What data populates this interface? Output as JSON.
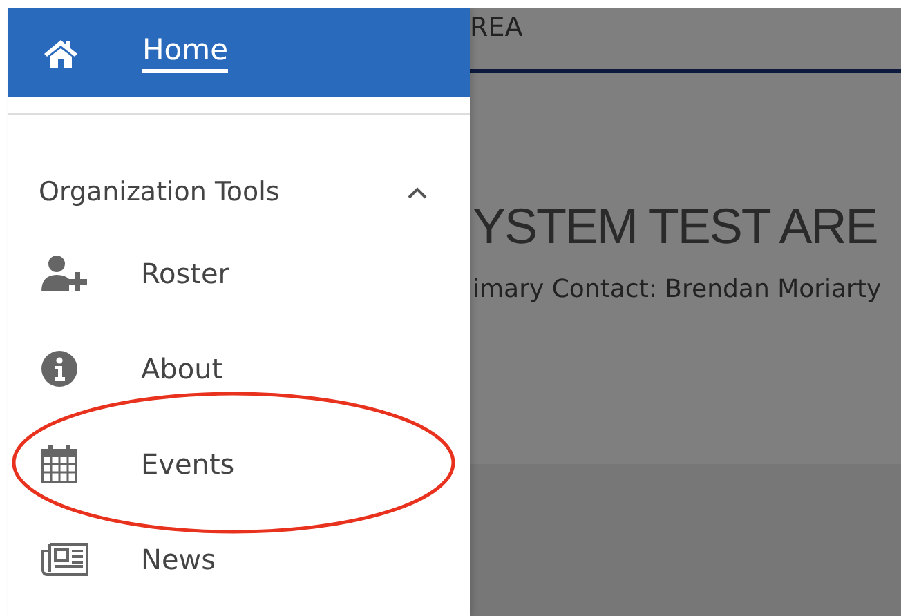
{
  "drawer": {
    "home": {
      "label": "Home",
      "selected": true
    },
    "section": {
      "title": "Organization Tools",
      "expanded": true
    },
    "items": [
      {
        "kind": "roster",
        "label": "Roster",
        "circled": false
      },
      {
        "kind": "about",
        "label": "About",
        "circled": false
      },
      {
        "kind": "events",
        "label": "Events",
        "circled": true
      },
      {
        "kind": "news",
        "label": "News",
        "circled": false
      }
    ]
  },
  "page": {
    "header_text": "REA",
    "title": "YSTEM TEST ARE",
    "contact": "imary Contact: Brendan Moriarty"
  }
}
